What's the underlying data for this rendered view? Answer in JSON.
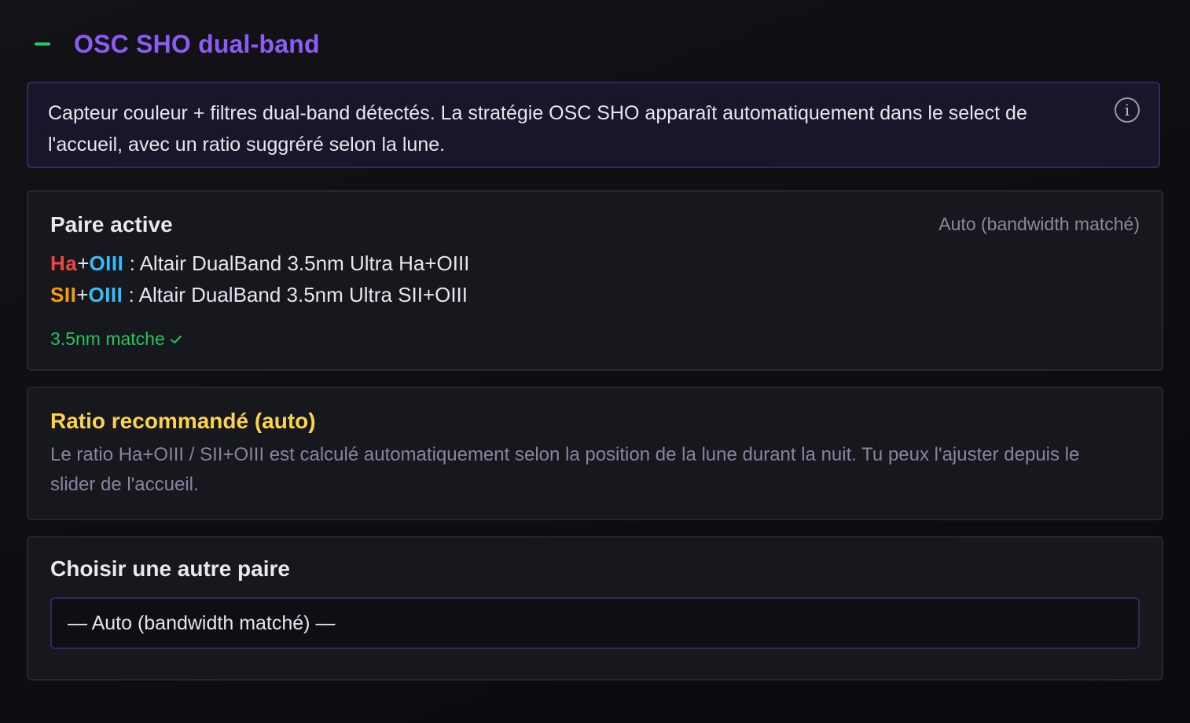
{
  "section": {
    "title": "OSC SHO dual-band",
    "toggle_symbol": "collapse"
  },
  "info_box": {
    "text": "Capteur couleur + filtres dual-band détectés. La stratégie OSC SHO apparaît automatiquement dans le select de l'accueil, avec un ratio suggréré selon la lune.",
    "icon": "info-icon",
    "icon_glyph": "i"
  },
  "active_pair": {
    "title": "Paire active",
    "mode": "Auto (bandwidth matché)",
    "pairs": [
      {
        "band1": "Ha",
        "plus": "+",
        "band2": "OIII",
        "separator": " : ",
        "filter": "Altair DualBand 3.5nm Ultra Ha+OIII"
      },
      {
        "band1": "SII",
        "plus": "+",
        "band2": "OIII",
        "separator": " : ",
        "filter": "Altair DualBand 3.5nm Ultra SII+OIII"
      }
    ],
    "match_status": "3.5nm matche"
  },
  "ratio": {
    "title": "Ratio recommandé (auto)",
    "description": "Le ratio Ha+OIII / SII+OIII est calculé automatiquement selon la position de la lune durant la nuit. Tu peux l'ajuster depuis le slider de l'accueil."
  },
  "choose_pair": {
    "title": "Choisir une autre paire",
    "selected": "— Auto (bandwidth matché) —"
  },
  "colors": {
    "accent_purple": "#8b5cf6",
    "green": "#22c55e",
    "ha_red": "#ef4444",
    "oiii_blue": "#38bdf8",
    "sii_orange": "#f59e0b",
    "ratio_yellow": "#fcd34d"
  }
}
